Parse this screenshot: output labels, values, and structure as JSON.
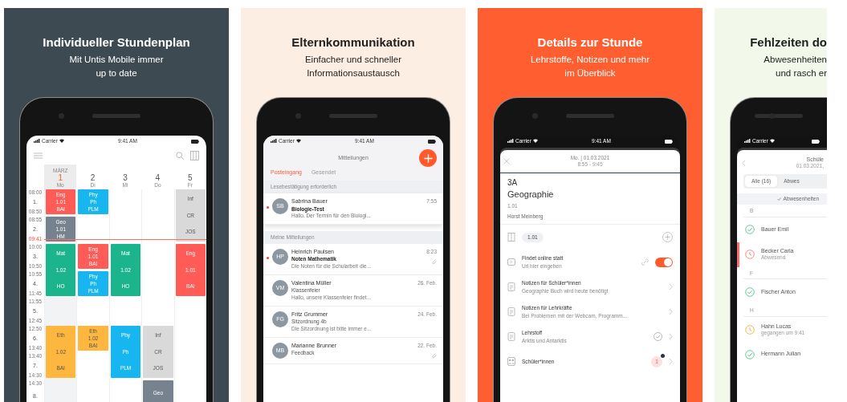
{
  "cards": [
    {
      "kind": "timetable",
      "color": "#3e4a52",
      "title": "Individueller Stundenplan",
      "subtitle": [
        "Mit Untis Mobile immer",
        "up to date"
      ],
      "screen": {
        "status_bar": {
          "carrier": "Carrier",
          "time": "9:41 AM"
        },
        "periods": [
          {
            "start": "08:00",
            "number": "1.",
            "end": "08:50"
          },
          {
            "start": "08:55",
            "number": "2.",
            "now": "09:41"
          },
          {
            "start": "10:00",
            "number": "3.",
            "end": "10:50"
          },
          {
            "start": "10:55",
            "number": "4.",
            "end": "11:45"
          },
          {
            "start": "11:55",
            "number": "5.",
            "end": "12:45"
          },
          {
            "start": "12:50",
            "number": "6.",
            "end": "13:40"
          },
          {
            "start": "13:40",
            "number": "7.",
            "end": "14:30"
          },
          {
            "start": "14:30",
            "number": "8."
          }
        ],
        "days": [
          {
            "month": "MÄRZ",
            "number": "1",
            "weekday": "Mo",
            "selected": true,
            "slots": [
              {
                "kind": "single",
                "color": "#ff5b57",
                "lines": [
                  "Eng",
                  "1.01",
                  "BAI"
                ]
              },
              {
                "kind": "single",
                "color": "#76838f",
                "lines": [
                  "Geo",
                  "1.01",
                  "HM"
                ]
              },
              {
                "kind": "double",
                "color": "#1cb48c",
                "lines": [
                  "Mat",
                  "1.02",
                  "HO"
                ]
              },
              {
                "kind": "free"
              },
              {
                "kind": "double",
                "color": "#fdb73e",
                "lines": [
                  "Eth",
                  "1.02",
                  "BAI"
                ]
              },
              {
                "kind": "free"
              }
            ]
          },
          {
            "number": "2",
            "weekday": "Di",
            "selected": false,
            "slots": [
              {
                "kind": "single",
                "color": "#18b6f0",
                "lines": [
                  "Phy",
                  "Ph",
                  "PLM"
                ]
              },
              {
                "kind": "free"
              },
              {
                "kind": "single",
                "color": "#ff5b57",
                "lines": [
                  "Eng",
                  "1.01",
                  "BAI"
                ]
              },
              {
                "kind": "single",
                "color": "#18b6f0",
                "lines": [
                  "Phy",
                  "Ph",
                  "PLM"
                ]
              },
              {
                "kind": "free"
              },
              {
                "kind": "single",
                "color": "#fdb73e",
                "lines": [
                  "Eth",
                  "1.02",
                  "BAI"
                ]
              },
              {
                "kind": "free"
              },
              {
                "kind": "free"
              }
            ]
          },
          {
            "number": "3",
            "weekday": "Mi",
            "selected": false,
            "slots": [
              {
                "kind": "free"
              },
              {
                "kind": "free"
              },
              {
                "kind": "double",
                "color": "#1cb48c",
                "lines": [
                  "Mat",
                  "1.02",
                  "HO"
                ]
              },
              {
                "kind": "free"
              },
              {
                "kind": "double",
                "color": "#18b6f0",
                "lines": [
                  "Phy",
                  "Ph",
                  "PLM"
                ]
              },
              {
                "kind": "free"
              }
            ]
          },
          {
            "number": "4",
            "weekday": "Do",
            "selected": false,
            "slots": [
              {
                "kind": "free"
              },
              {
                "kind": "free"
              },
              {
                "kind": "free"
              },
              {
                "kind": "free"
              },
              {
                "kind": "free"
              },
              {
                "kind": "double",
                "color": "#d9d9d9",
                "lines": [
                  "Inf",
                  "CR",
                  "JOS"
                ]
              },
              {
                "kind": "single",
                "color": "#76838f",
                "lines": [
                  "Geo"
                ]
              }
            ]
          },
          {
            "number": "5",
            "weekday": "Fr",
            "selected": false,
            "slots": [
              {
                "kind": "double",
                "color": "#d9d9d9",
                "lines": [
                  "Inf",
                  "CR",
                  "JOS"
                ]
              },
              {
                "kind": "double",
                "color": "#ff5b57",
                "lines": [
                  "Eng",
                  "1.01",
                  "BAI"
                ]
              },
              {
                "kind": "free"
              },
              {
                "kind": "free"
              },
              {
                "kind": "free"
              },
              {
                "kind": "free"
              }
            ]
          }
        ]
      }
    },
    {
      "kind": "messages",
      "color": "#fdeee3",
      "title": "Elternkommunikation",
      "subtitle": [
        "Einfacher und schneller",
        "Informationsaustausch"
      ],
      "screen": {
        "status_bar": {
          "carrier": "Carrier",
          "time": "9:41 AM"
        },
        "title": "Mitteilungen",
        "tabs": [
          {
            "label": "Posteingang",
            "selected": true
          },
          {
            "label": "Gesendet",
            "selected": false
          }
        ],
        "sections": [
          {
            "heading": "Lesebestätigung erforderlich",
            "messages": [
              {
                "initials": "SB",
                "sender": "Sabrina Bauer",
                "subject": "Biologie-Test",
                "preview": "Hallo. Der Termin für den Biologi...",
                "time": "7:55",
                "unread": true,
                "attachment": false
              }
            ]
          },
          {
            "heading": "Meine Mitteilungen",
            "messages": [
              {
                "initials": "HP",
                "sender": "Heinrich Paulsen",
                "subject": "Noten Mathematik",
                "preview": "Die Noten für die Schularbeit die...",
                "time": "8:23",
                "unread": true,
                "attachment": true
              },
              {
                "initials": "VM",
                "sender": "Valentina Müller",
                "subject": "Klassenfeier",
                "preview": "Hallo, unsere Klassenfeier findet...",
                "time": "26. Feb.",
                "unread": false,
                "attachment": false
              },
              {
                "initials": "FG",
                "sender": "Fritz Grummer",
                "subject": "Sitzordnung 4b",
                "preview": "Die Sitzordnung ist bitte immer e...",
                "time": "24. Feb.",
                "unread": false,
                "attachment": false
              },
              {
                "initials": "MB",
                "sender": "Marianne Brunner",
                "subject": "Feedback",
                "time": "22. Feb.",
                "unread": false,
                "attachment": true
              }
            ]
          }
        ]
      }
    },
    {
      "kind": "lesson",
      "color": "#ff5f30",
      "title": "Details zur Stunde",
      "subtitle": [
        "Lehrstoffe, Notizen und mehr",
        "im Überblick"
      ],
      "screen": {
        "status_bar": {
          "carrier": "Carrier",
          "time": "9:41 AM"
        },
        "date": "Mo. | 01.03.2021",
        "time_range": "8:55 - 9:45",
        "class": "3A",
        "subject": "Geographie",
        "room": "1.01",
        "teacher": "Horst Meinberg",
        "room_chip": "1.01",
        "rows": [
          {
            "kind": "toggle",
            "title": "Findet online statt",
            "subtitle": "Url hier eingeben",
            "on": true
          },
          {
            "kind": "link",
            "title": "Notizen für Schüler*innen",
            "subtitle": "Geographie Buch wird heute benötigt"
          },
          {
            "kind": "link",
            "title": "Notizen für Lehrkräfte",
            "subtitle": "Bei Problemen mit der Webcam, Programm..."
          },
          {
            "kind": "done",
            "title": "Lehrstoff",
            "subtitle": "Arktis und Antarktis"
          },
          {
            "kind": "count",
            "title": "Schüler*innen",
            "badge": "1"
          }
        ]
      }
    },
    {
      "kind": "absences",
      "color": "#f2f8ea",
      "title": "Fehlzeiten do",
      "subtitle": [
        "Abwesenheiten",
        "und rasch er"
      ],
      "screen": {
        "status_bar": {
          "carrier": "Carrier"
        },
        "title": "Schüle",
        "date": "01.03.2021,",
        "segments": [
          {
            "label": "Alle (16)",
            "selected": true
          },
          {
            "label": "Abwes",
            "selected": false
          }
        ],
        "banner": "Abwesenheiten",
        "groups": [
          {
            "letter": "B",
            "students": [
              {
                "name": "Bauer Emil",
                "kind": "present"
              },
              {
                "name": "Becker Carla",
                "note": "Abwesend",
                "kind": "absent"
              }
            ]
          },
          {
            "letter": "F",
            "students": [
              {
                "name": "Fischer Anton",
                "kind": "present"
              }
            ]
          },
          {
            "letter": "H",
            "students": [
              {
                "name": "Hahn Lucas",
                "note": "gegangen um 9:41",
                "kind": "left"
              },
              {
                "name": "Hermann Julian",
                "kind": "present"
              }
            ]
          }
        ]
      }
    }
  ]
}
